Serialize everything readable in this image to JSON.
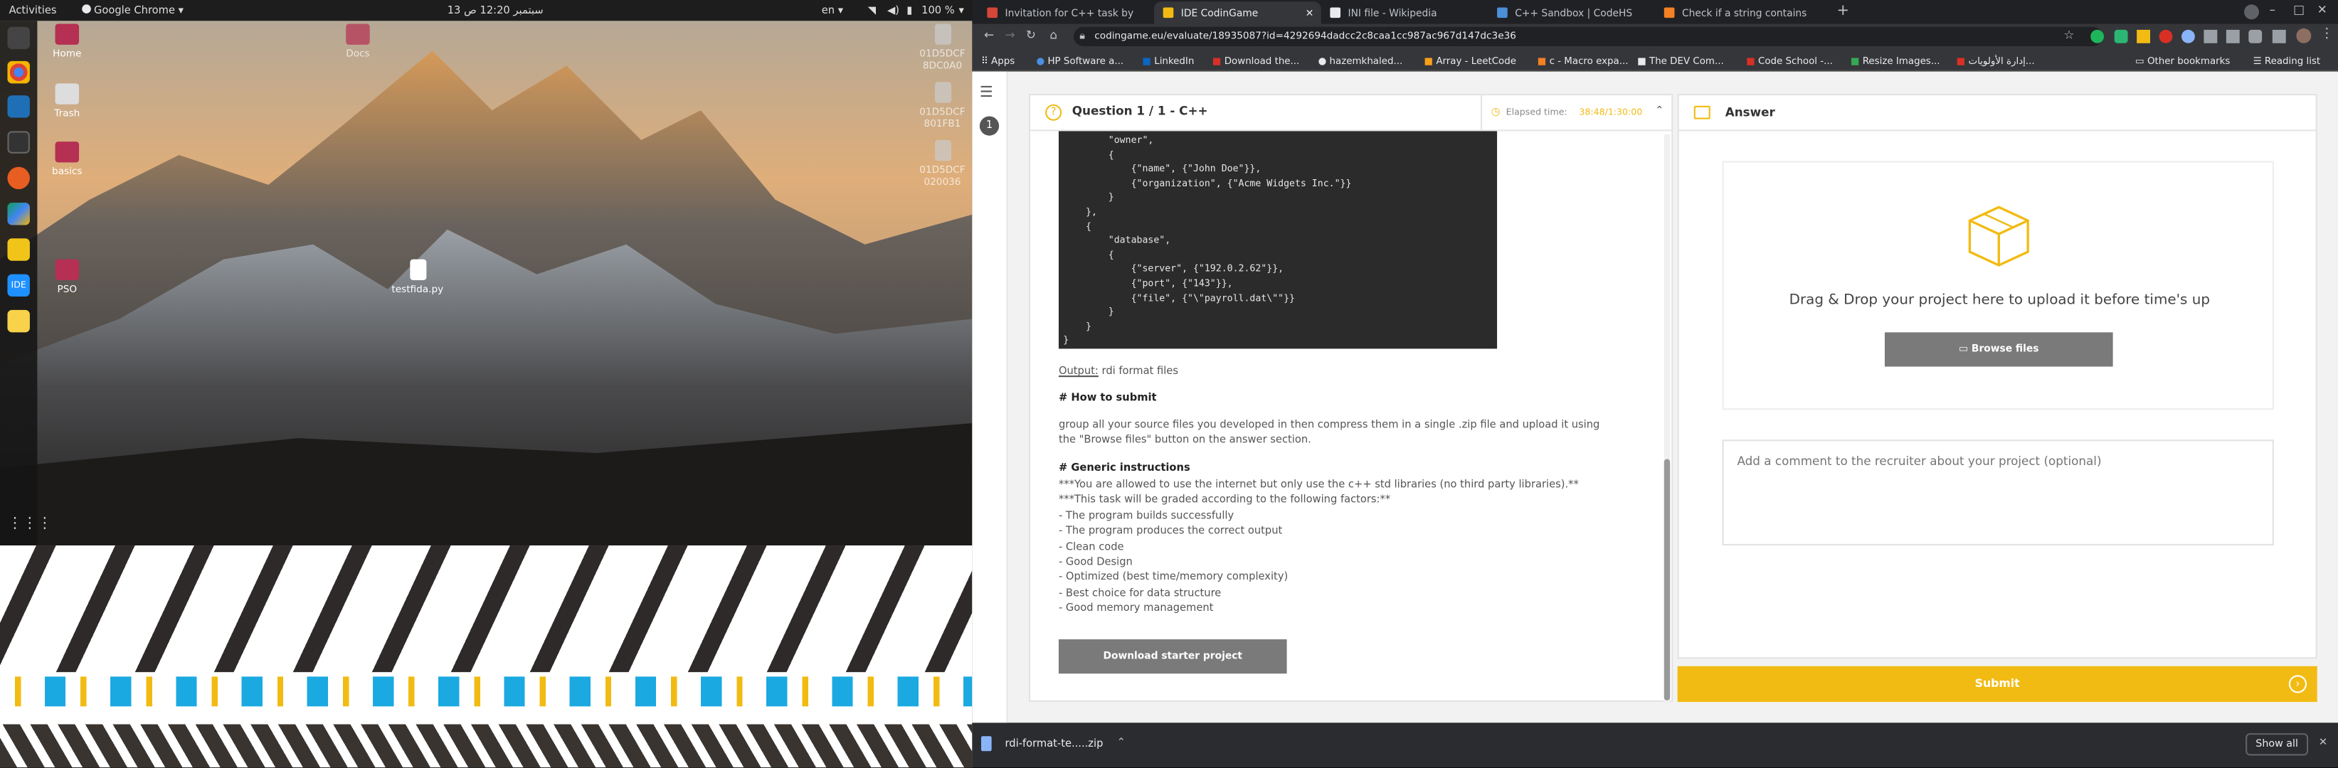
{
  "topbar": {
    "activities": "Activities",
    "app": "Google Chrome",
    "datetime": "13 سبتمبر 12:20 ص",
    "lang": "en",
    "battery": "100 %"
  },
  "desktop_icons": [
    {
      "label": "Home"
    },
    {
      "label": "Trash"
    },
    {
      "label": "basics"
    },
    {
      "label": "PSO"
    },
    {
      "label": "Docs"
    },
    {
      "label": "testfida.py"
    }
  ],
  "drives": [
    {
      "label": "01D5DCF 8DC0A0"
    },
    {
      "label": "01D5DCF 801FB1"
    },
    {
      "label": "01D5DCF 020036"
    }
  ],
  "tabs": [
    {
      "label": "Invitation for C++ task by",
      "fav": "#d44638"
    },
    {
      "label": "IDE CodinGame",
      "fav": "#f2bb13"
    },
    {
      "label": "INI file - Wikipedia",
      "fav": "#e8eaed"
    },
    {
      "label": "C++ Sandbox | CodeHS",
      "fav": "#4a8fd8"
    },
    {
      "label": "Check if a string contains",
      "fav": "#f48024"
    }
  ],
  "url": "codingame.eu/evaluate/18935087?id=4292694dadcc2c8caa1cc987ac967d147dc3e36",
  "bookmarks": [
    {
      "label": "Apps"
    },
    {
      "label": "HP Software a..."
    },
    {
      "label": "LinkedIn"
    },
    {
      "label": "Download the..."
    },
    {
      "label": "hazemkhaled..."
    },
    {
      "label": "Array - LeetCode"
    },
    {
      "label": "c - Macro expa..."
    },
    {
      "label": "The DEV Com..."
    },
    {
      "label": "Code School -..."
    },
    {
      "label": "Resize Images..."
    },
    {
      "label": "إدارة الأولويات..."
    },
    {
      "label": "Other bookmarks"
    },
    {
      "label": "Reading list"
    }
  ],
  "question": {
    "number": "1",
    "title": "Question 1 / 1 - C++",
    "elapsed_label": "Elapsed time:",
    "elapsed_value": "38:48/1:30:00",
    "code_lines": [
      "        \"owner\",",
      "        {",
      "            {\"name\", {\"John Doe\"}},",
      "            {\"organization\", {\"Acme Widgets Inc.\"}}",
      "        }",
      "    },",
      "    {",
      "        \"database\",",
      "        {",
      "            {\"server\", {\"192.0.2.62\"}},",
      "            {\"port\", {\"143\"}},",
      "            {\"file\", {\"\\\"payroll.dat\\\"\"}}",
      "        }",
      "    }",
      "}"
    ],
    "output_label": "Output:",
    "output_value": " rdi format files",
    "h_submit": "# How to submit",
    "submit_text": "group all your source files you developed in then compress them in a single .zip file and upload it using the \"Browse files\" button on the answer section.",
    "h_generic": "# Generic instructions",
    "generic_lines": [
      "***You are allowed to use the internet but only use the c++ std libraries (no third party libraries).**",
      "***This task will be graded according to the following factors:**",
      "- The program builds successfully",
      "- The program produces the correct output",
      "- Clean code",
      "- Good Design",
      "- Optimized (best time/memory complexity)",
      "- Best choice for data structure",
      "- Good memory management"
    ],
    "download_btn": "Download starter project"
  },
  "answer": {
    "title": "Answer",
    "drop_text": "Drag & Drop your project here to upload it before time's up",
    "browse_btn": "Browse files",
    "comment_placeholder": "Add a comment to the recruiter about your project (optional)",
    "submit_btn": "Submit"
  },
  "download": {
    "file": "rdi-format-te.....zip",
    "show_all": "Show all"
  },
  "colors": {
    "accent": "#f2bb13",
    "code_bg": "#2b2b2b",
    "button_gray": "#7a7a7a"
  }
}
